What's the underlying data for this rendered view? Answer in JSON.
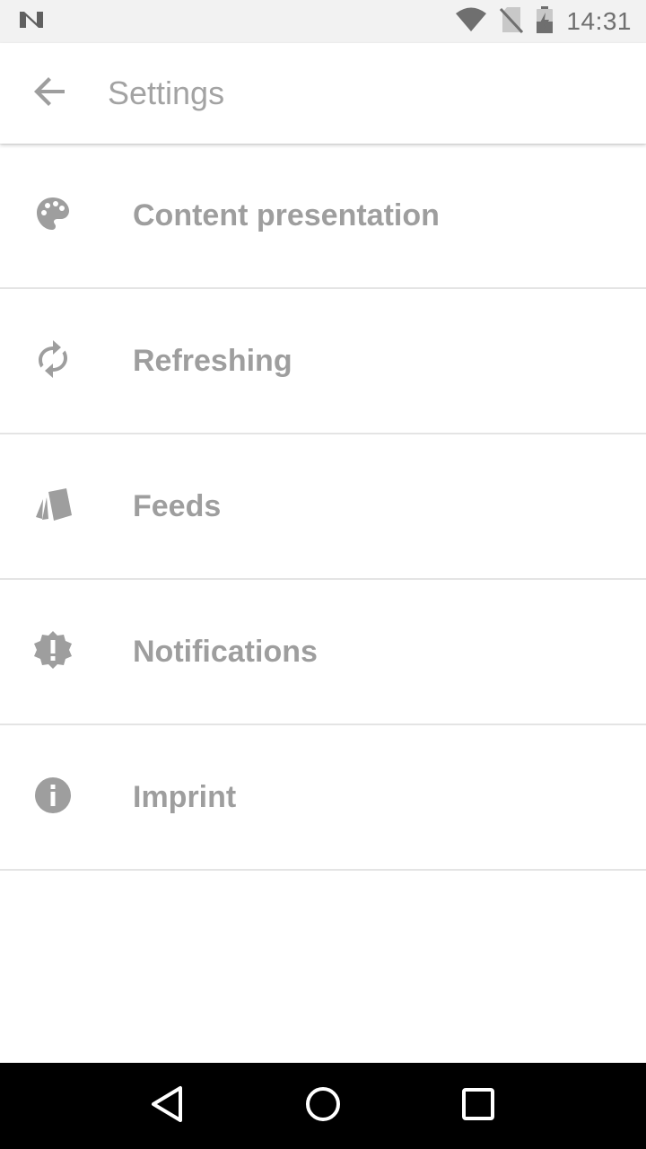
{
  "status_bar": {
    "time": "14:31",
    "icons": [
      "n-logo-icon",
      "wifi-icon",
      "no-sim-icon",
      "battery-charging-icon"
    ]
  },
  "app_bar": {
    "title": "Settings",
    "back_icon": "arrow-back-icon"
  },
  "settings": {
    "items": [
      {
        "label": "Content presentation",
        "icon": "palette-icon"
      },
      {
        "label": "Refreshing",
        "icon": "refresh-icon"
      },
      {
        "label": "Feeds",
        "icon": "cards-icon"
      },
      {
        "label": "Notifications",
        "icon": "alert-badge-icon"
      },
      {
        "label": "Imprint",
        "icon": "info-icon"
      }
    ]
  },
  "nav_bar": {
    "icons": [
      "back-triangle-icon",
      "home-circle-icon",
      "recents-square-icon"
    ]
  },
  "colors": {
    "icon": "#9e9e9e",
    "text": "#9e9e9e",
    "divider": "#e4e4e4",
    "status_bar_bg": "#f2f2f2",
    "nav_bar_bg": "#000000"
  }
}
